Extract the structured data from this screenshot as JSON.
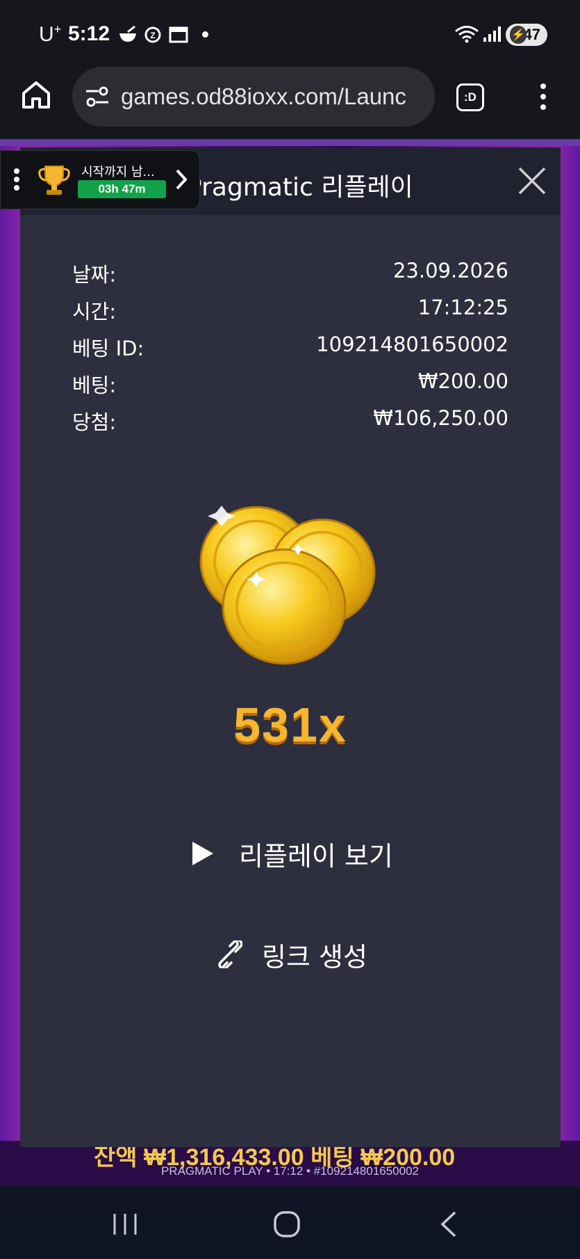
{
  "status_bar": {
    "carrier": "U",
    "carrier_sup": "+",
    "time": "5:12",
    "battery": "47"
  },
  "browser": {
    "url": "games.od88ioxx.com/Launc",
    "tab_label": ":D"
  },
  "tournament": {
    "label": "시작까지 남...",
    "timer": "03h 47m"
  },
  "modal": {
    "title": "Pragmatic 리플레이",
    "details": [
      {
        "label": "날짜:",
        "value": "23.09.2026"
      },
      {
        "label": "시간:",
        "value": "17:12:25"
      },
      {
        "label": "베팅 ID:",
        "value": "109214801650002"
      },
      {
        "label": "베팅:",
        "value": "₩200.00"
      },
      {
        "label": "당첨:",
        "value": "₩106,250.00"
      }
    ],
    "multiplier": "531x",
    "replay_label": "리플레이 보기",
    "link_label": "링크 생성"
  },
  "game_footer": {
    "balance_line": "잔액 ₩1,316,433.00  베팅 ₩200.00",
    "info_line": "PRAGMATIC PLAY • 17:12 • #109214801650002"
  },
  "colors": {
    "modal_bg": "#2d2f3e",
    "header_bg": "#202230",
    "multiplier": "#f5b630",
    "timer_badge": "#12a24a"
  }
}
